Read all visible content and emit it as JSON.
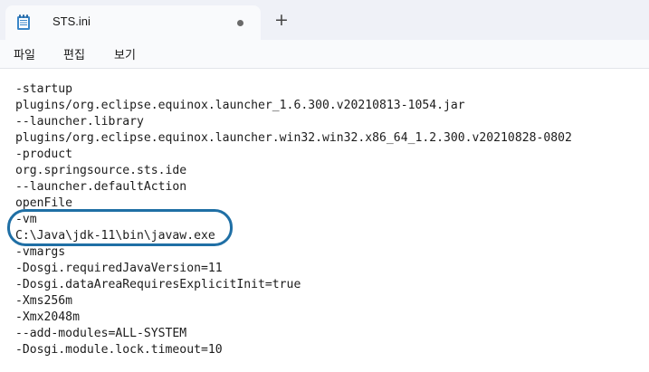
{
  "window": {
    "tab_title": "STS.ini",
    "new_tab_symbol": "+"
  },
  "icons": {
    "file": "notepad-file-icon",
    "unsaved": "unsaved-dot-icon",
    "add": "plus-icon"
  },
  "menu": [
    {
      "label": "파일"
    },
    {
      "label": "편집"
    },
    {
      "label": "보기"
    }
  ],
  "editor": {
    "lines": [
      "-startup",
      "plugins/org.eclipse.equinox.launcher_1.6.300.v20210813-1054.jar",
      "--launcher.library",
      "plugins/org.eclipse.equinox.launcher.win32.win32.x86_64_1.2.300.v20210828-0802",
      "-product",
      "org.springsource.sts.ide",
      "--launcher.defaultAction",
      "openFile",
      "-vm",
      "C:\\Java\\jdk-11\\bin\\javaw.exe",
      "-vmargs",
      "-Dosgi.requiredJavaVersion=11",
      "-Dosgi.dataAreaRequiresExplicitInit=true",
      "-Xms256m",
      "-Xmx2048m",
      "--add-modules=ALL-SYSTEM",
      "-Dosgi.module.lock.timeout=10"
    ]
  },
  "colors": {
    "highlight_outline": "#1f6fa5",
    "titlebar": "#eff1f7",
    "editor_bg": "#ffffff"
  }
}
